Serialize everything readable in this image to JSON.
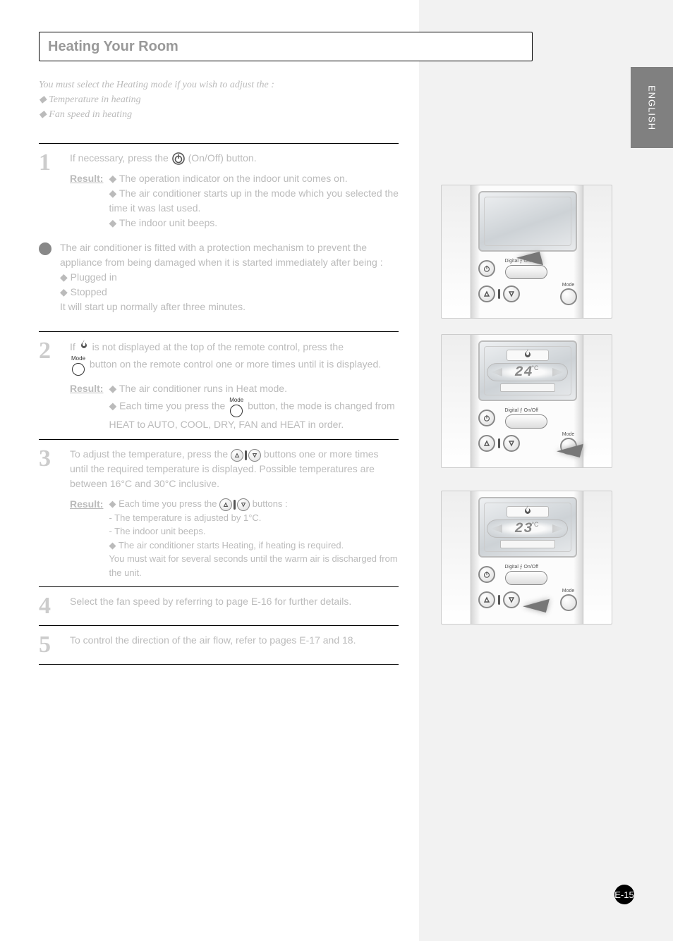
{
  "sideTab": "ENGLISH",
  "title": "Heating Your Room",
  "intro": "You must select the Heating mode if you wish to adjust the :\n◆ Temperature in heating\n◆ Fan speed in heating",
  "steps": {
    "s1": {
      "line1": "If necessary, press the",
      "line1b": "(On/Off) button.",
      "resultLabel": "Result:",
      "resultItems": [
        "◆ The operation indicator on the indoor unit comes on.",
        "◆ The air conditioner starts up in the mode which you selected the time it was last used.",
        "◆ The indoor unit beeps."
      ]
    },
    "bullet": "The air conditioner is fitted with a protection mechanism to prevent the appliance from being damaged when it is started immediately after being :\n◆ Plugged in\n◆ Stopped\nIt will start up normally after three minutes.",
    "s2": {
      "line1": "If",
      "line1b": "is not displayed at the top of the remote control, press the",
      "line2": "button on the remote control one or more times until it is displayed.",
      "resultLabel": "Result:",
      "resultItems": [
        "◆ The air conditioner runs in Heat mode.",
        "◆ Each time you press the",
        "button, the mode is changed from HEAT to AUTO, COOL, DRY, FAN and HEAT in order."
      ]
    },
    "s3": {
      "line1": "To adjust the temperature, press the",
      "line1b": "buttons one or more times",
      "line2": "until the required temperature is displayed. Possible temperatures are",
      "line3": "between 16°C and 30°C inclusive.",
      "resultLabel": "Result:",
      "resultItems": [
        "◆ Each time you press the",
        "buttons :",
        "- The temperature is adjusted by 1°C.",
        "- The indoor unit beeps.",
        "◆ The air conditioner starts Heating, if heating is required.",
        "You must wait for several seconds until the warm air is discharged from the unit."
      ]
    },
    "s4": "Select the fan speed by referring to page E-16 for further details.",
    "s5": "To control the direction of the air flow, refer to pages E-17 and 18."
  },
  "remotes": {
    "labelDigital": "Digital ⨍ On/Off",
    "labelMode": "Mode",
    "r2temp": "24",
    "r3temp": "23",
    "deg": "°C"
  },
  "pageNum": "E-15"
}
